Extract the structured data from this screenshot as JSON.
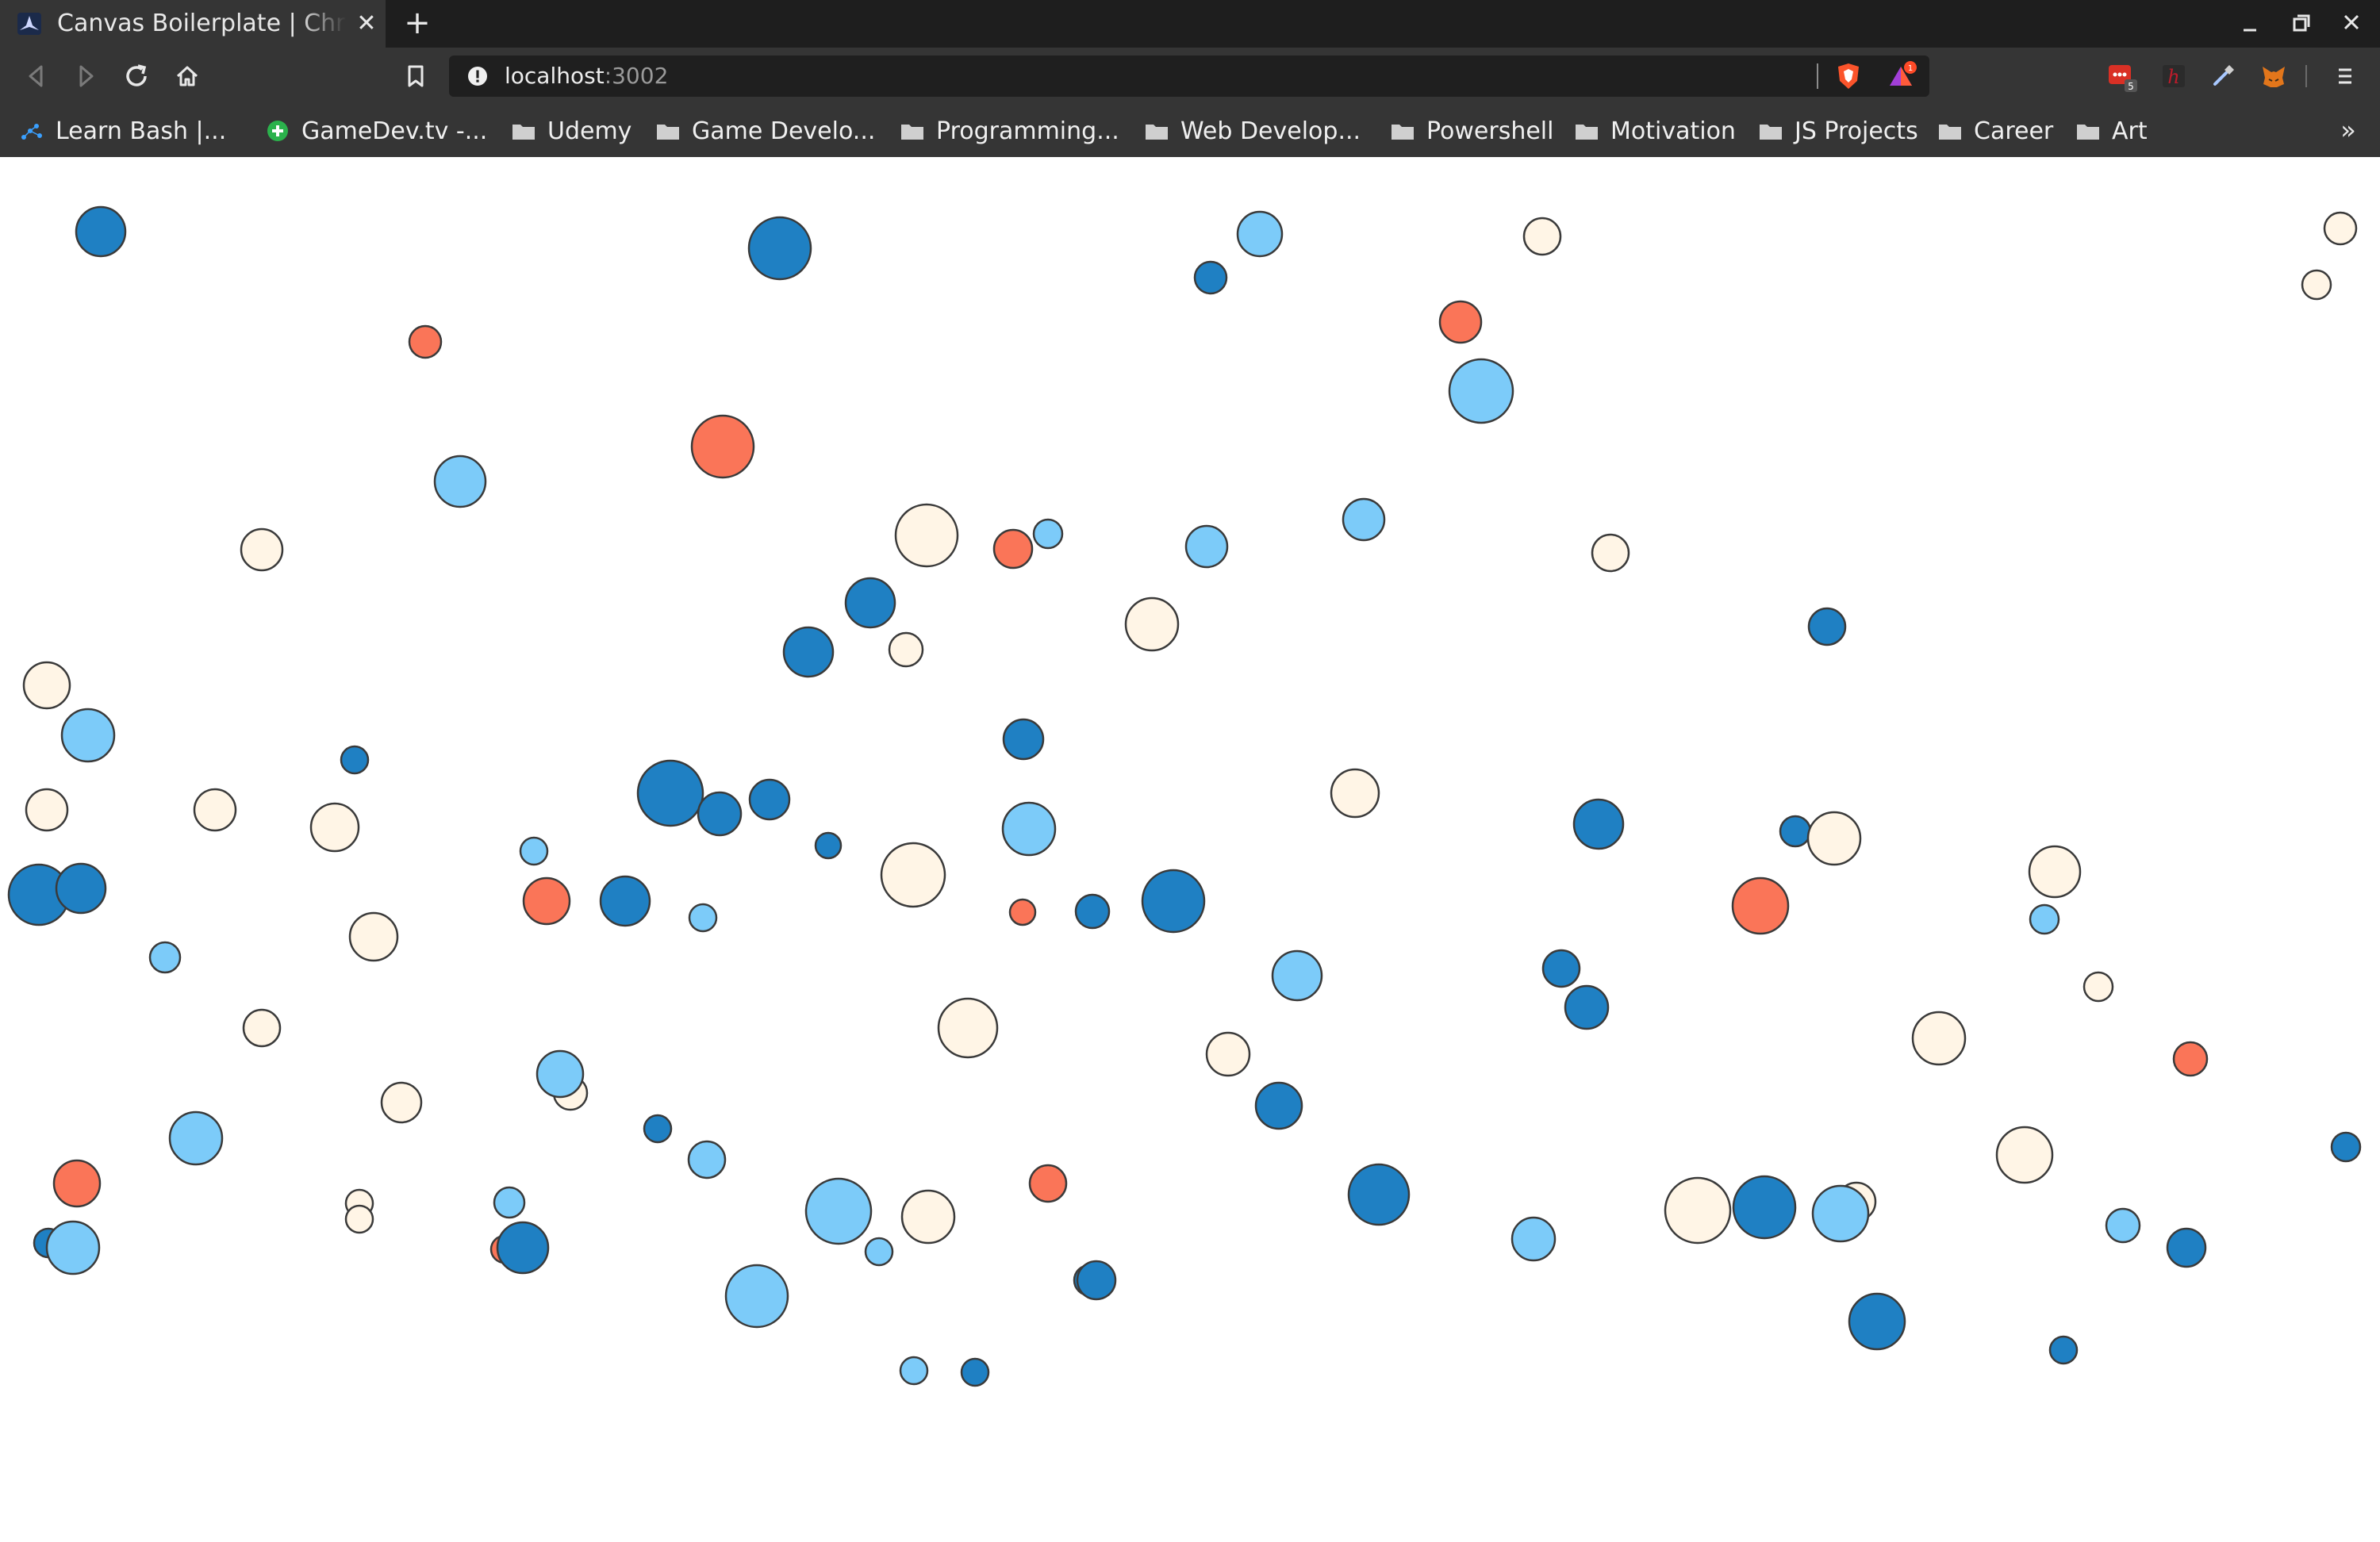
{
  "browser": {
    "tab": {
      "title": "Canvas Boilerplate | Chris",
      "close_icon": "close-icon"
    },
    "new_tab_icon": "plus-icon",
    "window_controls": [
      "minimize-icon",
      "restore-icon",
      "close-icon"
    ],
    "address_bar": {
      "host": "localhost",
      "port": ":3002",
      "security_icon": "info-icon"
    },
    "extensions": [
      {
        "name": "brave-shields-icon",
        "color": "#fb542b"
      },
      {
        "name": "brave-rewards-icon",
        "badge": "1"
      },
      {
        "name": "extension-badge-icon",
        "badge": "5",
        "color": "#d93025"
      },
      {
        "name": "hypothesis-icon",
        "color": "#bd1c2b"
      },
      {
        "name": "eyedropper-icon"
      },
      {
        "name": "metamask-icon",
        "color": "#e2761b"
      }
    ],
    "bookmarks": [
      {
        "label": "Learn Bash |...",
        "icon": "bash-icon"
      },
      {
        "label": "GameDev.tv -...",
        "icon": "gamedev-icon"
      },
      {
        "label": "Udemy",
        "icon": "folder-icon"
      },
      {
        "label": "Game Develo...",
        "icon": "folder-icon"
      },
      {
        "label": "Programming...",
        "icon": "folder-icon"
      },
      {
        "label": "Web Develop...",
        "icon": "folder-icon"
      },
      {
        "label": "Powershell",
        "icon": "folder-icon"
      },
      {
        "label": "Motivation",
        "icon": "folder-icon"
      },
      {
        "label": "JS Projects",
        "icon": "folder-icon"
      },
      {
        "label": "Career",
        "icon": "folder-icon"
      },
      {
        "label": "Art",
        "icon": "folder-icon"
      }
    ],
    "bookmarks_more": "»"
  },
  "canvas": {
    "palette": {
      "dark_blue": "#1f80c3",
      "light_blue": "#7ccbf9",
      "cream": "#fff5e6",
      "coral": "#fa7558",
      "stroke": "#3a3a3a"
    }
  }
}
